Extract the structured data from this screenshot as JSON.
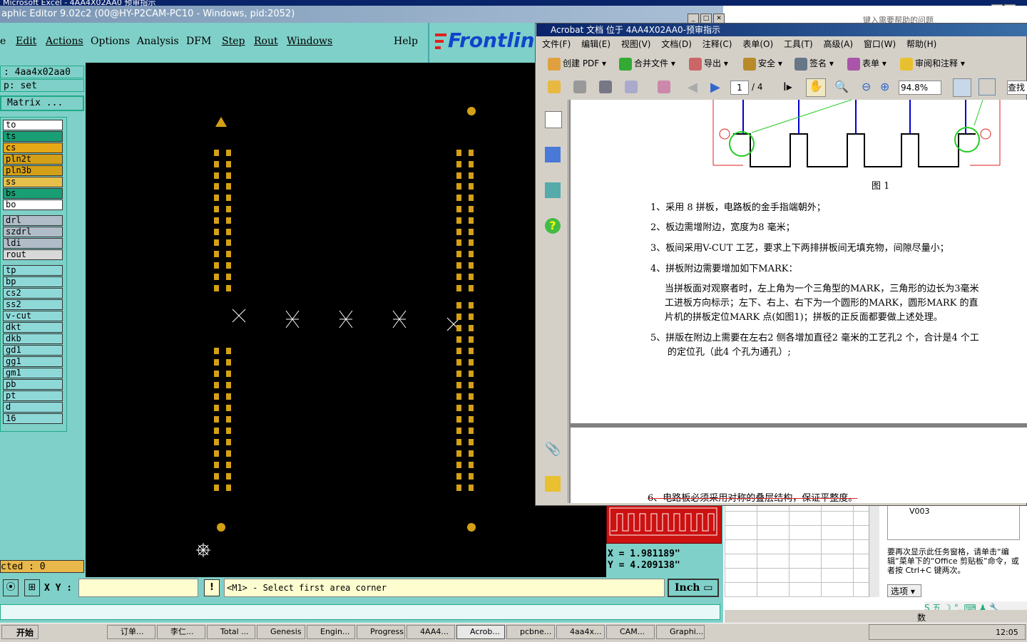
{
  "excel": {
    "title": "Microsoft Excel - 4AA4X02AA0 预审指示",
    "help_placeholder": "键入需要帮助的问题",
    "taskpane_item": "V003",
    "taskpane_text": "要再次显示此任务窗格，请单击“编辑”菜单下的“Office 剪贴板”命令，或者按 Ctrl+C 键两次。",
    "options_button": "选项 ▾",
    "status_count": "数"
  },
  "frontline": {
    "title": "aphic Editor 9.02c2 (00@HY-P2CAM-PC10 - Windows, pid:2052)",
    "menu": [
      "e",
      "Edit",
      "Actions",
      "Options",
      "Analysis",
      "DFM",
      "Step",
      "Rout",
      "Windows"
    ],
    "help": "Help",
    "logo": "Frontlin",
    "job_info": ": 4aa4x02aa0",
    "step_info": "p: set",
    "matrix_button": "Matrix ...",
    "layers": [
      {
        "name": "to",
        "color": "#ffffff"
      },
      {
        "name": "ts",
        "color": "#1a9e74"
      },
      {
        "name": "cs",
        "color": "#e6a817"
      },
      {
        "name": "pln2t",
        "color": "#d4a017"
      },
      {
        "name": "pln3b",
        "color": "#d4a017"
      },
      {
        "name": "ss",
        "color": "#e6c04a"
      },
      {
        "name": "bs",
        "color": "#1a9e74"
      },
      {
        "name": "bo",
        "color": "#ffffff"
      },
      {
        "name": "drl",
        "color": "#b0bcc8"
      },
      {
        "name": "szdrl",
        "color": "#b0bcc8"
      },
      {
        "name": "ldi",
        "color": "#b0bcc8"
      },
      {
        "name": "rout",
        "color": "#d8d8d8"
      },
      {
        "name": "tp",
        "color": "#8fd8d8"
      },
      {
        "name": "bp",
        "color": "#8fd8d8"
      },
      {
        "name": "cs2",
        "color": "#8fd8d8"
      },
      {
        "name": "ss2",
        "color": "#8fd8d8"
      },
      {
        "name": "v-cut",
        "color": "#8fd8d8"
      },
      {
        "name": "dkt",
        "color": "#8fd8d8"
      },
      {
        "name": "dkb",
        "color": "#8fd8d8"
      },
      {
        "name": "gd1",
        "color": "#8fd8d8"
      },
      {
        "name": "gg1",
        "color": "#8fd8d8"
      },
      {
        "name": "gm1",
        "color": "#8fd8d8"
      },
      {
        "name": "pb",
        "color": "#8fd8d8"
      },
      {
        "name": "pt",
        "color": "#8fd8d8"
      },
      {
        "name": "d",
        "color": "#8fd8d8"
      },
      {
        "name": "16",
        "color": "#8fd8d8"
      }
    ],
    "selected": "cted : 0",
    "coord_x": "X = 1.981189\"",
    "coord_y": "Y = 4.209138\"",
    "xy_label": "X Y :",
    "xy_value": "",
    "prompt": "<M1> - Select first area corner",
    "unit": "Inch ▭",
    "pad_color": "#d4a017"
  },
  "acrobat": {
    "title": "Acrobat 文档 位于 4AA4X02AA0-预审指示",
    "menu": [
      "文件(F)",
      "编辑(E)",
      "视图(V)",
      "文档(D)",
      "注释(C)",
      "表单(O)",
      "工具(T)",
      "高级(A)",
      "窗口(W)",
      "帮助(H)"
    ],
    "tools": [
      "创建 PDF ▾",
      "合并文件 ▾",
      "导出 ▾",
      "安全 ▾",
      "签名 ▾",
      "表单 ▾",
      "审阅和注释 ▾"
    ],
    "page_current": "1",
    "page_total": "/ 4",
    "zoom": "94.8%",
    "search": "查找",
    "figure_caption": "图 1",
    "items": [
      "1、采用 8 拼板，电路板的金手指端朝外；",
      "2、板边需增附边，宽度为8 毫米；",
      "3、板间采用V-CUT 工艺，要求上下两排拼板间无填充物，间隙尽量小；",
      "4、拼板附边需要增加如下MARK："
    ],
    "item4_body": [
      "当拼板面对观察者时，左上角为一个三角型的MARK，三角形的边长为3毫米",
      "工进板方向标示；左下、右上、右下为一个圆形的MARK，圆形MARK 的直",
      "片机的拼板定位MARK 点(如图1)；拼板的正反面都要做上述处理。"
    ],
    "item5": [
      "5、拼版在附边上需要在左右2 侧各增加直径2 毫米的工艺孔2 个，合计是4 个工",
      "的定位孔（此4 个孔为通孔）;"
    ],
    "item6": "6、电路板必须采用对称的叠层结构，保证平整度。"
  },
  "taskbar": {
    "start": "开始",
    "tasks": [
      "订单...",
      "李仁...",
      "Total ...",
      "Genesis",
      "Engin...",
      "Progress",
      "4AA4...",
      "Acrob...",
      "pcbne...",
      "4aa4x...",
      "CAM...",
      "Graphi..."
    ],
    "clock": "12:05"
  }
}
